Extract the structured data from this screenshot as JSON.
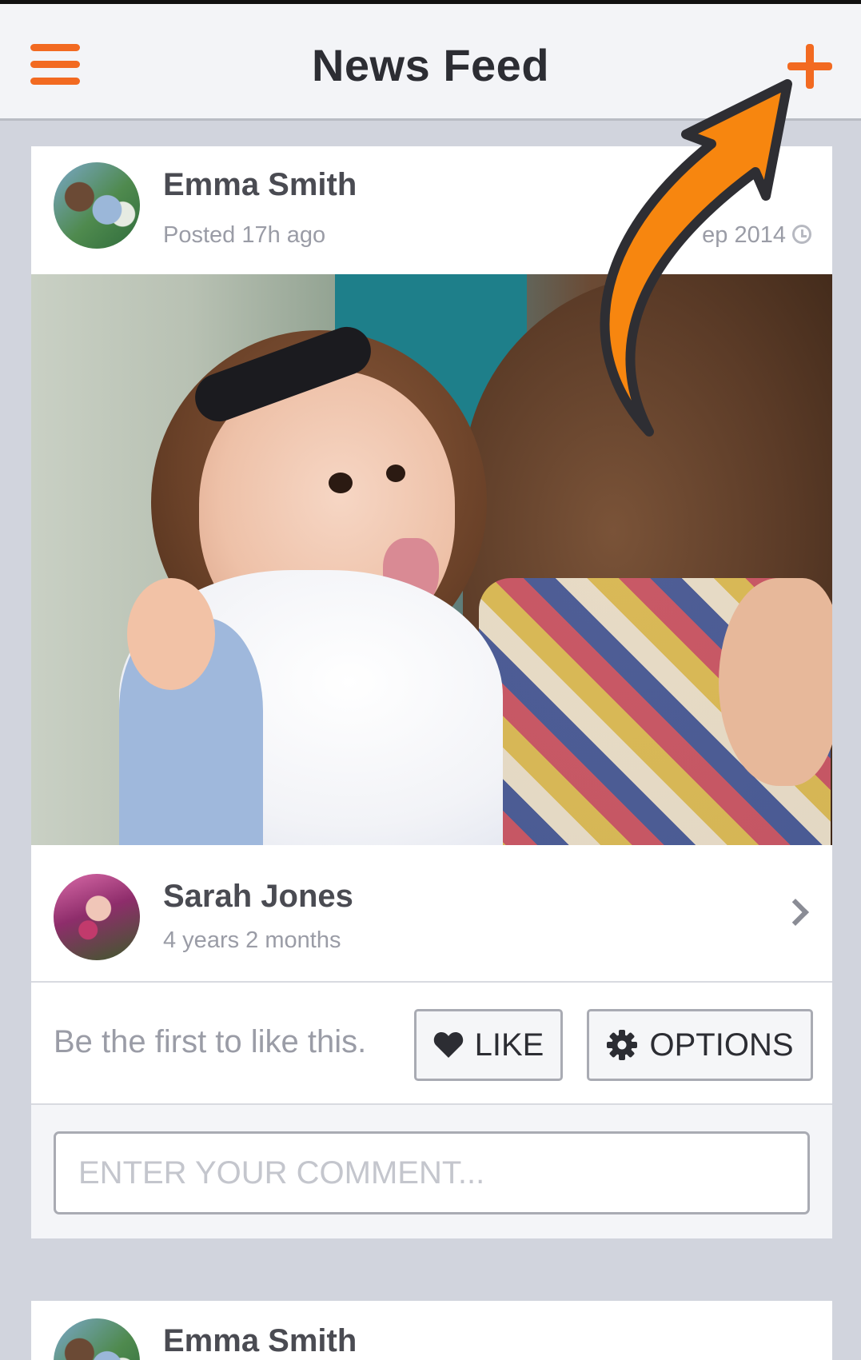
{
  "header": {
    "title": "News Feed",
    "menu_icon": "hamburger-menu-icon",
    "add_icon": "plus-icon",
    "accent_color": "#f26a21"
  },
  "post": {
    "author": "Emma Smith",
    "posted": "Posted 17h ago",
    "date": "ep 2014",
    "date_icon": "clock-icon",
    "tagged": {
      "name": "Sarah Jones",
      "age": "4 years 2 months",
      "chevron_icon": "chevron-right-icon"
    },
    "likes_text": "Be the first to like this.",
    "like_label": "LIKE",
    "like_icon": "heart-icon",
    "options_label": "OPTIONS",
    "options_icon": "gear-icon",
    "comment_placeholder": "ENTER YOUR COMMENT..."
  },
  "next_post": {
    "author": "Emma Smith"
  },
  "annotation": {
    "arrow_icon": "orange-arrow-icon",
    "arrow_color": "#f7860f"
  }
}
